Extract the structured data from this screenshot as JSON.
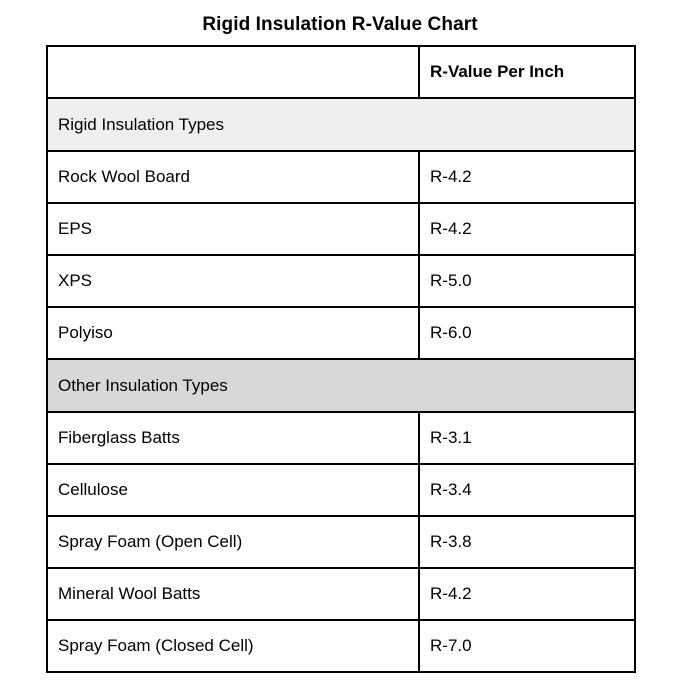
{
  "page": {
    "title": "Rigid Insulation R-Value Chart",
    "background": "#ffffff"
  },
  "colors": {
    "border": "#000000",
    "text": "#000000",
    "section_rigid_background": "#efefef",
    "section_other_background": "#d8d8d8",
    "row_background": "#ffffff"
  },
  "table": {
    "columns": [
      {
        "key": "name",
        "header": ""
      },
      {
        "key": "value",
        "header": "R-Value Per Inch"
      }
    ],
    "sections": [
      {
        "label": "Rigid Insulation Types",
        "rows": [
          {
            "name": "Rock Wool Board",
            "value": "R-4.2"
          },
          {
            "name": "EPS",
            "value": "R-4.2"
          },
          {
            "name": "XPS",
            "value": "R-5.0"
          },
          {
            "name": "Polyiso",
            "value": "R-6.0"
          }
        ]
      },
      {
        "label": "Other Insulation Types",
        "rows": [
          {
            "name": "Fiberglass Batts",
            "value": "R-3.1"
          },
          {
            "name": "Cellulose",
            "value": "R-3.4"
          },
          {
            "name": "Spray Foam (Open Cell)",
            "value": "R-3.8"
          },
          {
            "name": "Mineral Wool Batts",
            "value": "R-4.2"
          },
          {
            "name": "Spray Foam (Closed Cell)",
            "value": "R-7.0"
          }
        ]
      }
    ]
  },
  "chart_data": {
    "type": "table",
    "title": "Rigid Insulation R-Value Chart",
    "xlabel": "",
    "ylabel": "R-Value Per Inch",
    "columns": [
      "",
      "R-Value Per Inch"
    ],
    "groups": [
      {
        "name": "Rigid Insulation Types",
        "categories": [
          "Rock Wool Board",
          "EPS",
          "XPS",
          "Polyiso"
        ],
        "values": [
          4.2,
          4.2,
          5.0,
          6.0
        ],
        "labels": [
          "R-4.2",
          "R-4.2",
          "R-5.0",
          "R-6.0"
        ]
      },
      {
        "name": "Other Insulation Types",
        "categories": [
          "Fiberglass Batts",
          "Cellulose",
          "Spray Foam (Open Cell)",
          "Mineral Wool Batts",
          "Spray Foam (Closed Cell)"
        ],
        "values": [
          3.1,
          3.4,
          3.8,
          4.2,
          7.0
        ],
        "labels": [
          "R-3.1",
          "R-3.4",
          "R-3.8",
          "R-4.2",
          "R-7.0"
        ]
      }
    ]
  }
}
